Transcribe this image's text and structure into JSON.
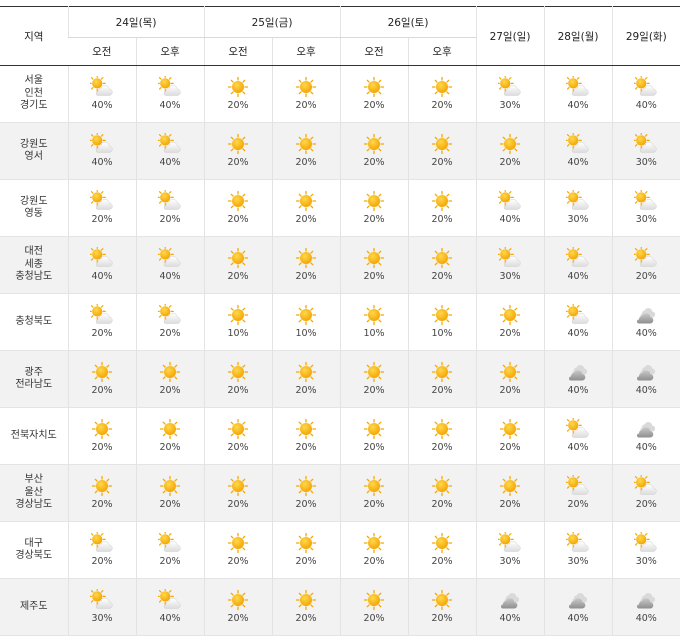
{
  "header": {
    "region": "지역",
    "days": [
      {
        "label": "24일(목)",
        "halves": [
          "오전",
          "오후"
        ]
      },
      {
        "label": "25일(금)",
        "halves": [
          "오전",
          "오후"
        ]
      },
      {
        "label": "26일(토)",
        "halves": [
          "오전",
          "오후"
        ]
      }
    ],
    "single_days": [
      "27일(일)",
      "28일(월)",
      "29일(화)"
    ]
  },
  "rows": [
    {
      "region": [
        "서울",
        "인천",
        "경기도"
      ],
      "cells": [
        {
          "icon": "partly-cloudy-icon",
          "pct": "40%"
        },
        {
          "icon": "partly-cloudy-icon",
          "pct": "40%"
        },
        {
          "icon": "sun-icon",
          "pct": "20%"
        },
        {
          "icon": "sun-icon",
          "pct": "20%"
        },
        {
          "icon": "sun-icon",
          "pct": "20%"
        },
        {
          "icon": "sun-icon",
          "pct": "20%"
        },
        {
          "icon": "partly-cloudy-icon",
          "pct": "30%"
        },
        {
          "icon": "partly-cloudy-icon",
          "pct": "40%"
        },
        {
          "icon": "partly-cloudy-icon",
          "pct": "40%"
        }
      ]
    },
    {
      "region": [
        "강원도",
        "영서"
      ],
      "cells": [
        {
          "icon": "partly-cloudy-icon",
          "pct": "40%"
        },
        {
          "icon": "partly-cloudy-icon",
          "pct": "40%"
        },
        {
          "icon": "sun-icon",
          "pct": "20%"
        },
        {
          "icon": "sun-icon",
          "pct": "20%"
        },
        {
          "icon": "sun-icon",
          "pct": "20%"
        },
        {
          "icon": "sun-icon",
          "pct": "20%"
        },
        {
          "icon": "sun-icon",
          "pct": "20%"
        },
        {
          "icon": "partly-cloudy-icon",
          "pct": "40%"
        },
        {
          "icon": "partly-cloudy-icon",
          "pct": "30%"
        }
      ]
    },
    {
      "region": [
        "강원도",
        "영동"
      ],
      "cells": [
        {
          "icon": "partly-cloudy-icon",
          "pct": "20%"
        },
        {
          "icon": "partly-cloudy-icon",
          "pct": "20%"
        },
        {
          "icon": "sun-icon",
          "pct": "20%"
        },
        {
          "icon": "sun-icon",
          "pct": "20%"
        },
        {
          "icon": "sun-icon",
          "pct": "20%"
        },
        {
          "icon": "sun-icon",
          "pct": "20%"
        },
        {
          "icon": "partly-cloudy-icon",
          "pct": "40%"
        },
        {
          "icon": "partly-cloudy-icon",
          "pct": "30%"
        },
        {
          "icon": "partly-cloudy-icon",
          "pct": "30%"
        }
      ]
    },
    {
      "region": [
        "대전",
        "세종",
        "충청남도"
      ],
      "cells": [
        {
          "icon": "partly-cloudy-icon",
          "pct": "40%"
        },
        {
          "icon": "partly-cloudy-icon",
          "pct": "40%"
        },
        {
          "icon": "sun-icon",
          "pct": "20%"
        },
        {
          "icon": "sun-icon",
          "pct": "20%"
        },
        {
          "icon": "sun-icon",
          "pct": "20%"
        },
        {
          "icon": "sun-icon",
          "pct": "20%"
        },
        {
          "icon": "partly-cloudy-icon",
          "pct": "30%"
        },
        {
          "icon": "partly-cloudy-icon",
          "pct": "40%"
        },
        {
          "icon": "partly-cloudy-icon",
          "pct": "20%"
        }
      ]
    },
    {
      "region": [
        "충청북도"
      ],
      "cells": [
        {
          "icon": "partly-cloudy-icon",
          "pct": "20%"
        },
        {
          "icon": "partly-cloudy-icon",
          "pct": "20%"
        },
        {
          "icon": "sun-icon",
          "pct": "10%"
        },
        {
          "icon": "sun-icon",
          "pct": "10%"
        },
        {
          "icon": "sun-icon",
          "pct": "10%"
        },
        {
          "icon": "sun-icon",
          "pct": "10%"
        },
        {
          "icon": "sun-icon",
          "pct": "20%"
        },
        {
          "icon": "partly-cloudy-icon",
          "pct": "40%"
        },
        {
          "icon": "cloudy-icon",
          "pct": "40%"
        }
      ]
    },
    {
      "region": [
        "광주",
        "전라남도"
      ],
      "cells": [
        {
          "icon": "sun-icon",
          "pct": "20%"
        },
        {
          "icon": "sun-icon",
          "pct": "20%"
        },
        {
          "icon": "sun-icon",
          "pct": "20%"
        },
        {
          "icon": "sun-icon",
          "pct": "20%"
        },
        {
          "icon": "sun-icon",
          "pct": "20%"
        },
        {
          "icon": "sun-icon",
          "pct": "20%"
        },
        {
          "icon": "sun-icon",
          "pct": "20%"
        },
        {
          "icon": "cloudy-icon",
          "pct": "40%"
        },
        {
          "icon": "cloudy-icon",
          "pct": "40%"
        }
      ]
    },
    {
      "region": [
        "전북자치도"
      ],
      "cells": [
        {
          "icon": "sun-icon",
          "pct": "20%"
        },
        {
          "icon": "sun-icon",
          "pct": "20%"
        },
        {
          "icon": "sun-icon",
          "pct": "20%"
        },
        {
          "icon": "sun-icon",
          "pct": "20%"
        },
        {
          "icon": "sun-icon",
          "pct": "20%"
        },
        {
          "icon": "sun-icon",
          "pct": "20%"
        },
        {
          "icon": "sun-icon",
          "pct": "20%"
        },
        {
          "icon": "partly-cloudy-icon",
          "pct": "40%"
        },
        {
          "icon": "cloudy-icon",
          "pct": "40%"
        }
      ]
    },
    {
      "region": [
        "부산",
        "울산",
        "경상남도"
      ],
      "cells": [
        {
          "icon": "sun-icon",
          "pct": "20%"
        },
        {
          "icon": "sun-icon",
          "pct": "20%"
        },
        {
          "icon": "sun-icon",
          "pct": "20%"
        },
        {
          "icon": "sun-icon",
          "pct": "20%"
        },
        {
          "icon": "sun-icon",
          "pct": "20%"
        },
        {
          "icon": "sun-icon",
          "pct": "20%"
        },
        {
          "icon": "sun-icon",
          "pct": "20%"
        },
        {
          "icon": "partly-cloudy-icon",
          "pct": "20%"
        },
        {
          "icon": "partly-cloudy-icon",
          "pct": "20%"
        }
      ]
    },
    {
      "region": [
        "대구",
        "경상북도"
      ],
      "cells": [
        {
          "icon": "partly-cloudy-icon",
          "pct": "20%"
        },
        {
          "icon": "partly-cloudy-icon",
          "pct": "20%"
        },
        {
          "icon": "sun-icon",
          "pct": "20%"
        },
        {
          "icon": "sun-icon",
          "pct": "20%"
        },
        {
          "icon": "sun-icon",
          "pct": "20%"
        },
        {
          "icon": "sun-icon",
          "pct": "20%"
        },
        {
          "icon": "partly-cloudy-icon",
          "pct": "30%"
        },
        {
          "icon": "partly-cloudy-icon",
          "pct": "30%"
        },
        {
          "icon": "partly-cloudy-icon",
          "pct": "30%"
        }
      ]
    },
    {
      "region": [
        "제주도"
      ],
      "cells": [
        {
          "icon": "partly-cloudy-icon",
          "pct": "30%"
        },
        {
          "icon": "partly-cloudy-icon",
          "pct": "40%"
        },
        {
          "icon": "sun-icon",
          "pct": "20%"
        },
        {
          "icon": "sun-icon",
          "pct": "20%"
        },
        {
          "icon": "sun-icon",
          "pct": "20%"
        },
        {
          "icon": "sun-icon",
          "pct": "20%"
        },
        {
          "icon": "cloudy-icon",
          "pct": "40%"
        },
        {
          "icon": "cloudy-icon",
          "pct": "40%"
        },
        {
          "icon": "cloudy-icon",
          "pct": "40%"
        }
      ]
    }
  ],
  "colors": {
    "sun": "#f7b500",
    "sun_ray": "#f5a800",
    "cloud_light": "#ececec",
    "cloud_gray": "#9a9a9a",
    "row_alt": "#f2f2f2"
  }
}
